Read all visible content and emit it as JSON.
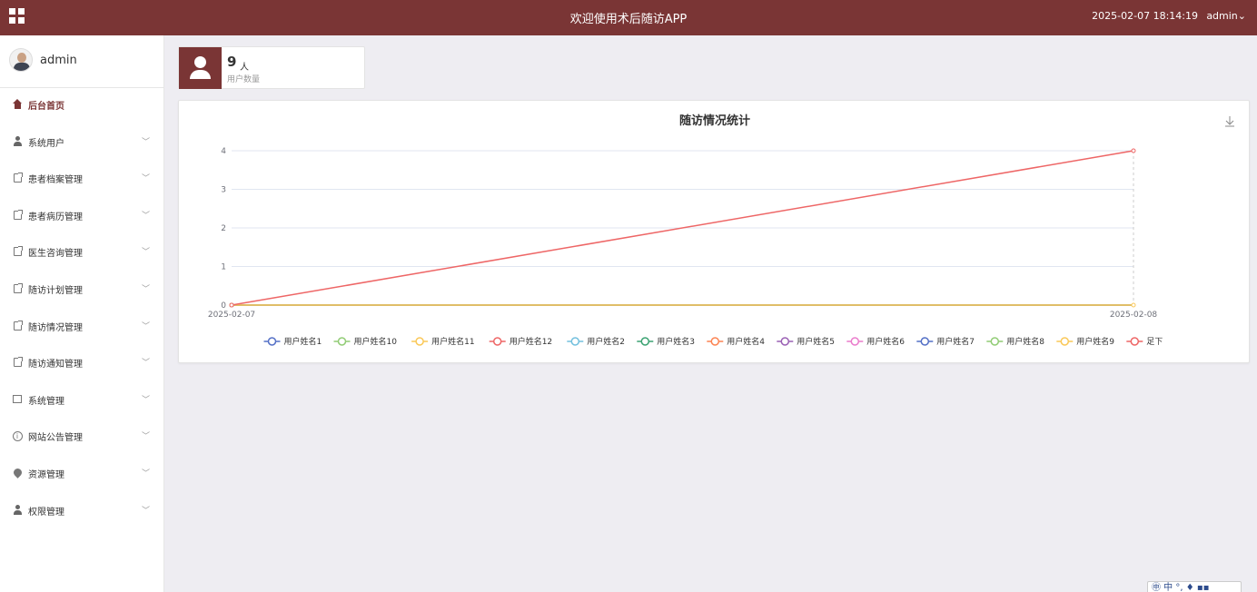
{
  "header": {
    "title": "欢迎使用术后随访APP",
    "datetime": "2025-02-07 18:14:19",
    "user": "admin⌄"
  },
  "sidebar": {
    "profile_name": "admin",
    "items": [
      {
        "label": "后台首页",
        "icon": "home-icon",
        "active": true
      },
      {
        "label": "系统用户",
        "icon": "user-icon"
      },
      {
        "label": "患者档案管理",
        "icon": "document-icon"
      },
      {
        "label": "患者病历管理",
        "icon": "document-icon"
      },
      {
        "label": "医生咨询管理",
        "icon": "document-icon"
      },
      {
        "label": "随访计划管理",
        "icon": "document-icon"
      },
      {
        "label": "随访情况管理",
        "icon": "document-icon"
      },
      {
        "label": "随访通知管理",
        "icon": "document-icon"
      },
      {
        "label": "系统管理",
        "icon": "image-icon"
      },
      {
        "label": "网站公告管理",
        "icon": "info-icon"
      },
      {
        "label": "资源管理",
        "icon": "location-icon"
      },
      {
        "label": "权限管理",
        "icon": "user-icon"
      }
    ]
  },
  "stat_card": {
    "value": "9",
    "unit": "人",
    "label": "用户数量"
  },
  "ime": {
    "text": "㊥ 中 °, ♦ ▪▪"
  },
  "chart_data": {
    "type": "line",
    "title": "随访情况统计",
    "x": [
      "2025-02-07",
      "2025-02-08"
    ],
    "ylim": [
      0,
      4
    ],
    "yticks": [
      0,
      1,
      2,
      3,
      4
    ],
    "grid": true,
    "legend_position": "bottom",
    "series": [
      {
        "name": "用户姓名1",
        "color": "#5470c6",
        "values": [
          0,
          0
        ]
      },
      {
        "name": "用户姓名10",
        "color": "#91cc75",
        "values": [
          0,
          0
        ]
      },
      {
        "name": "用户姓名11",
        "color": "#fac858",
        "values": [
          0,
          0
        ]
      },
      {
        "name": "用户姓名12",
        "color": "#ee6666",
        "values": [
          0,
          0
        ]
      },
      {
        "name": "用户姓名2",
        "color": "#73c0de",
        "values": [
          0,
          0
        ]
      },
      {
        "name": "用户姓名3",
        "color": "#3ba272",
        "values": [
          0,
          0
        ]
      },
      {
        "name": "用户姓名4",
        "color": "#fc8452",
        "values": [
          0,
          0
        ]
      },
      {
        "name": "用户姓名5",
        "color": "#9a60b4",
        "values": [
          0,
          0
        ]
      },
      {
        "name": "用户姓名6",
        "color": "#ea7ccc",
        "values": [
          0,
          0
        ]
      },
      {
        "name": "用户姓名7",
        "color": "#5470c6",
        "values": [
          0,
          0
        ]
      },
      {
        "name": "用户姓名8",
        "color": "#91cc75",
        "values": [
          0,
          0
        ]
      },
      {
        "name": "用户姓名9",
        "color": "#fac858",
        "values": [
          0,
          0
        ]
      },
      {
        "name": "足下",
        "color": "#ee6666",
        "values": [
          0,
          4
        ]
      }
    ]
  }
}
